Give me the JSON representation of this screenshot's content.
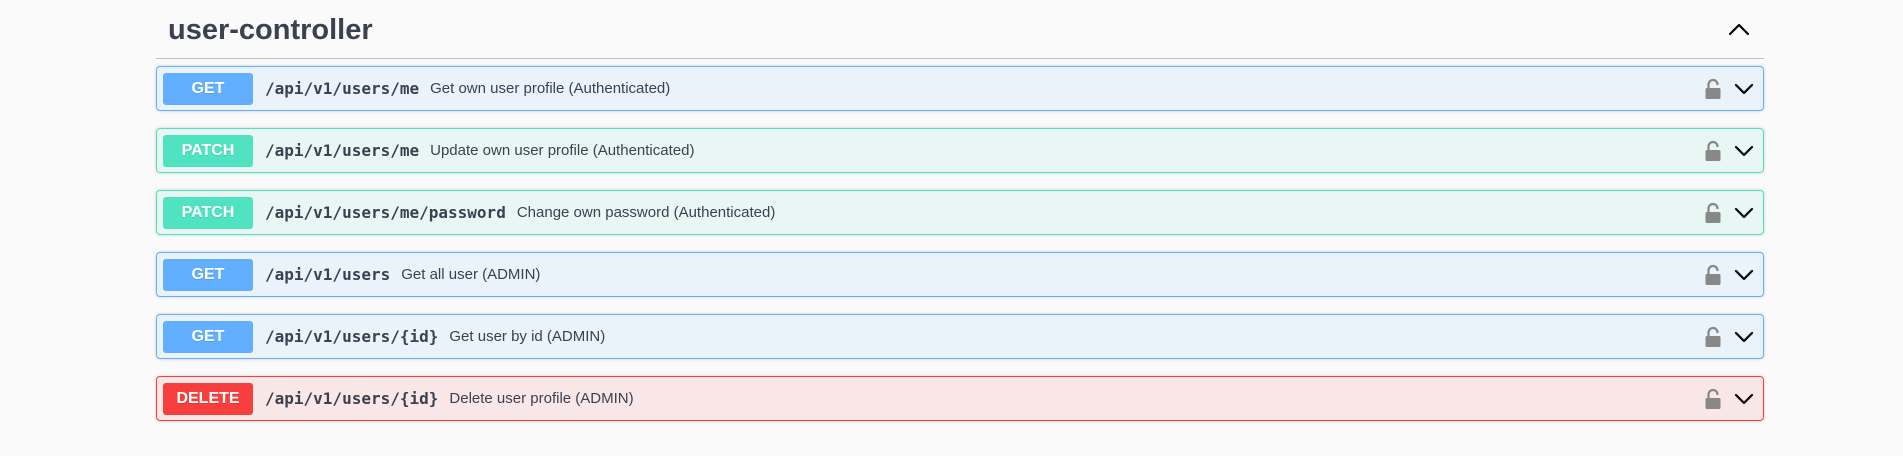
{
  "tag": {
    "title": "user-controller",
    "toggle_icon": "chevron-up-icon"
  },
  "operations": [
    {
      "method": "GET",
      "type": "get",
      "path": "/api/v1/users/me",
      "summary": "Get own user profile (Authenticated)"
    },
    {
      "method": "PATCH",
      "type": "patch",
      "path": "/api/v1/users/me",
      "summary": "Update own user profile (Authenticated)"
    },
    {
      "method": "PATCH",
      "type": "patch",
      "path": "/api/v1/users/me/password",
      "summary": "Change own password (Authenticated)"
    },
    {
      "method": "GET",
      "type": "get",
      "path": "/api/v1/users",
      "summary": "Get all user (ADMIN)"
    },
    {
      "method": "GET",
      "type": "get",
      "path": "/api/v1/users/{id}",
      "summary": "Get user by id (ADMIN)"
    },
    {
      "method": "DELETE",
      "type": "delete",
      "path": "/api/v1/users/{id}",
      "summary": "Delete user profile (ADMIN)"
    }
  ],
  "icons": {
    "lock": "lock-icon",
    "expand": "chevron-down-icon"
  },
  "colors": {
    "get": "#61affe",
    "patch": "#50e3c2",
    "delete": "#f93e3e",
    "text": "#3b4151"
  }
}
